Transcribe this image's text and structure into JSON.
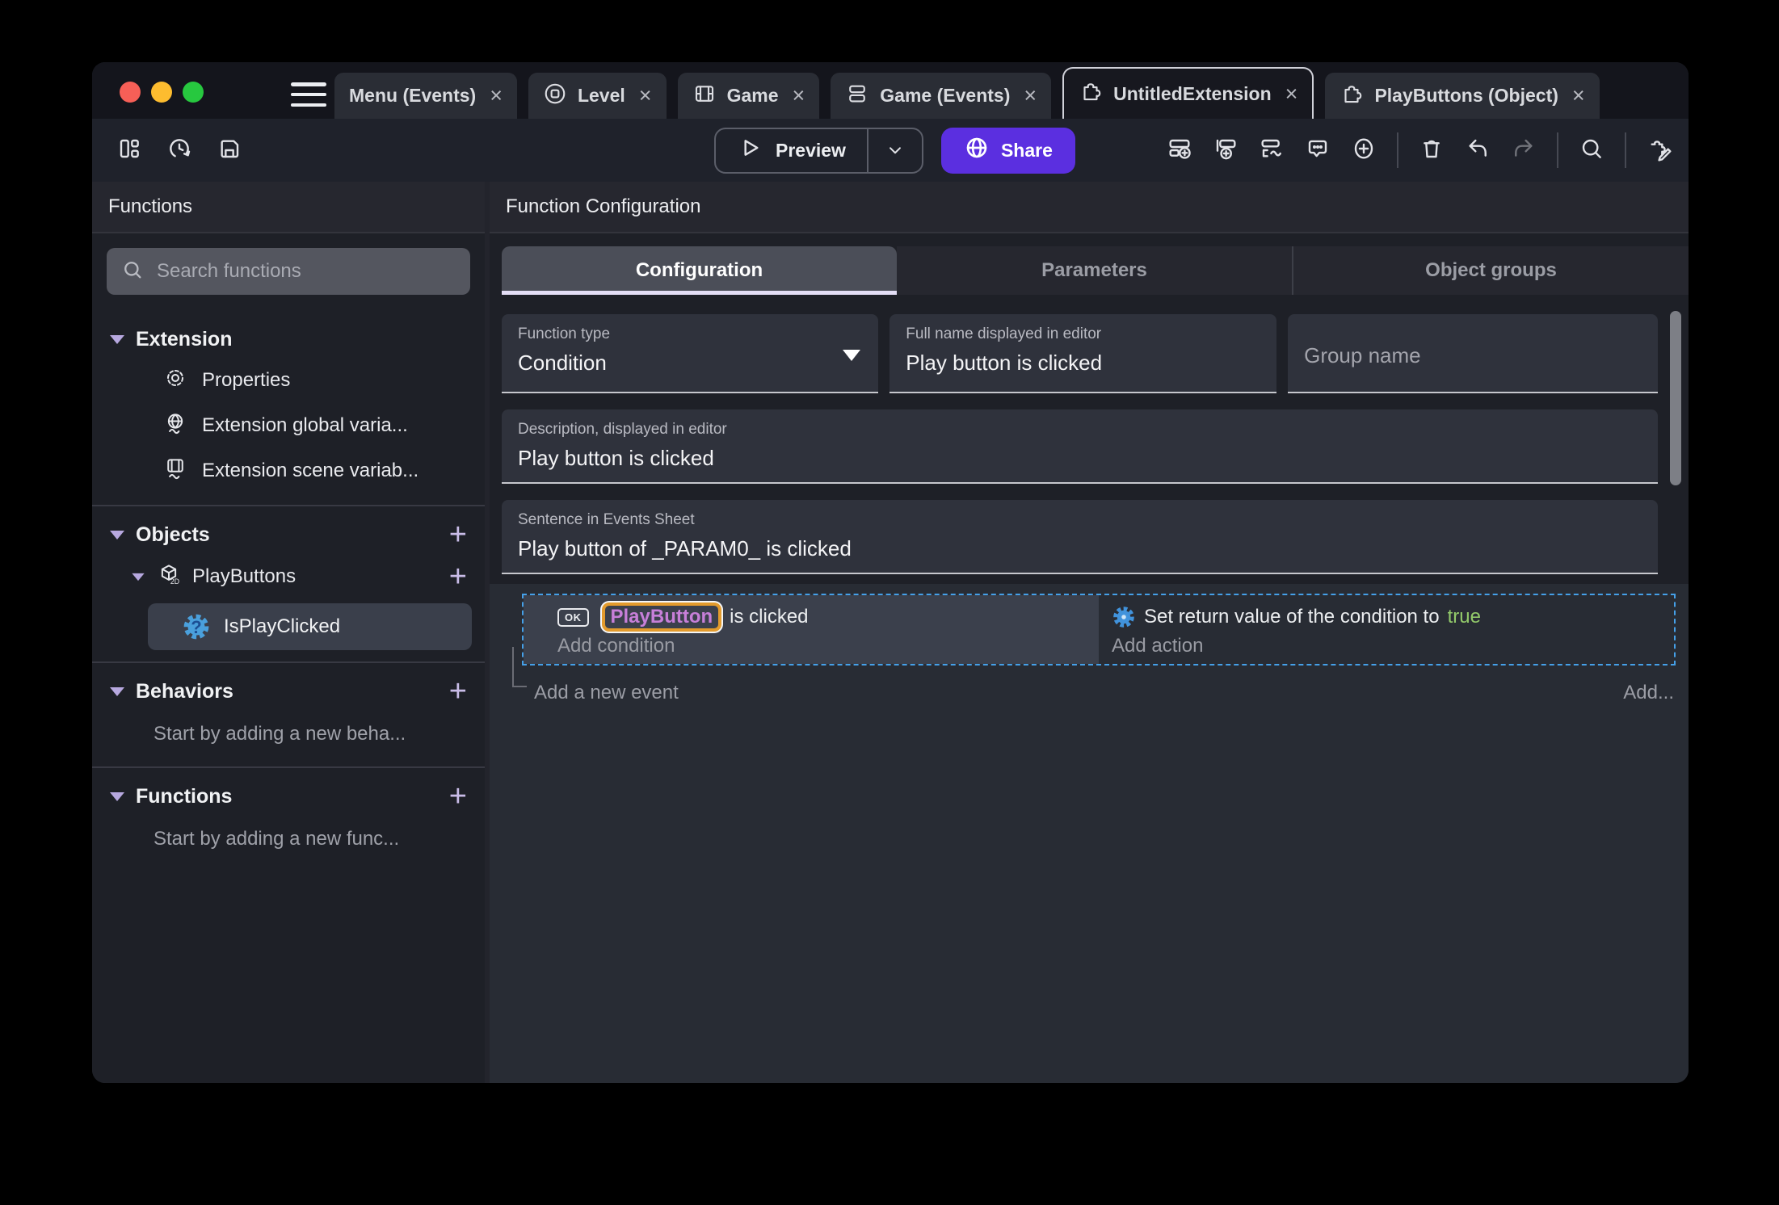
{
  "ui": {
    "close_glyph": "×"
  },
  "colors": {
    "accent_purple": "#5B2FE0",
    "object_text_purple": "#C77FD9",
    "object_outline_orange": "#E39B2D",
    "selection_dashed_blue": "#45A0E8",
    "true_green": "#92C96A",
    "traffic_red": "#F65F57",
    "traffic_yellow": "#FDBC2F",
    "traffic_green": "#27C83F"
  },
  "tabbar": {
    "tabs": [
      {
        "label": "Menu (Events)"
      },
      {
        "label": "Level"
      },
      {
        "label": "Game"
      },
      {
        "label": "Game (Events)"
      },
      {
        "label": "UntitledExtension"
      },
      {
        "label": "PlayButtons (Object)"
      }
    ]
  },
  "toolbar": {
    "preview_label": "Preview",
    "share_label": "Share"
  },
  "sidebar": {
    "title": "Functions",
    "search_placeholder": "Search functions",
    "extension_header": "Extension",
    "items": {
      "properties": "Properties",
      "global_vars": "Extension global varia...",
      "scene_vars": "Extension scene variab..."
    },
    "objects_header": "Objects",
    "objects_item": "PlayButtons",
    "objects_child": "IsPlayClicked",
    "behaviors_header": "Behaviors",
    "behaviors_empty": "Start by adding a new beha...",
    "functions_header": "Functions",
    "functions_empty": "Start by adding a new func..."
  },
  "main": {
    "header": "Function Configuration",
    "tabs": [
      {
        "label": "Configuration"
      },
      {
        "label": "Parameters"
      },
      {
        "label": "Object groups"
      }
    ],
    "fields": {
      "function_type": {
        "label": "Function type",
        "value": "Condition"
      },
      "full_name": {
        "label": "Full name displayed in editor",
        "value": "Play button is clicked"
      },
      "group_name": {
        "placeholder": "Group name"
      },
      "description": {
        "label": "Description, displayed in editor",
        "value": "Play button is clicked"
      },
      "sentence": {
        "label": "Sentence in Events Sheet",
        "value": "Play button of _PARAM0_ is clicked"
      }
    },
    "events": {
      "condition": {
        "object_icon_label": "OK",
        "object_name": "PlayButton",
        "suffix": "is clicked",
        "add_label": "Add condition"
      },
      "action": {
        "prefix": "Set return value of the condition to",
        "value": "true",
        "add_label": "Add action"
      },
      "add_new_event": "Add a new event",
      "add_more": "Add..."
    }
  }
}
